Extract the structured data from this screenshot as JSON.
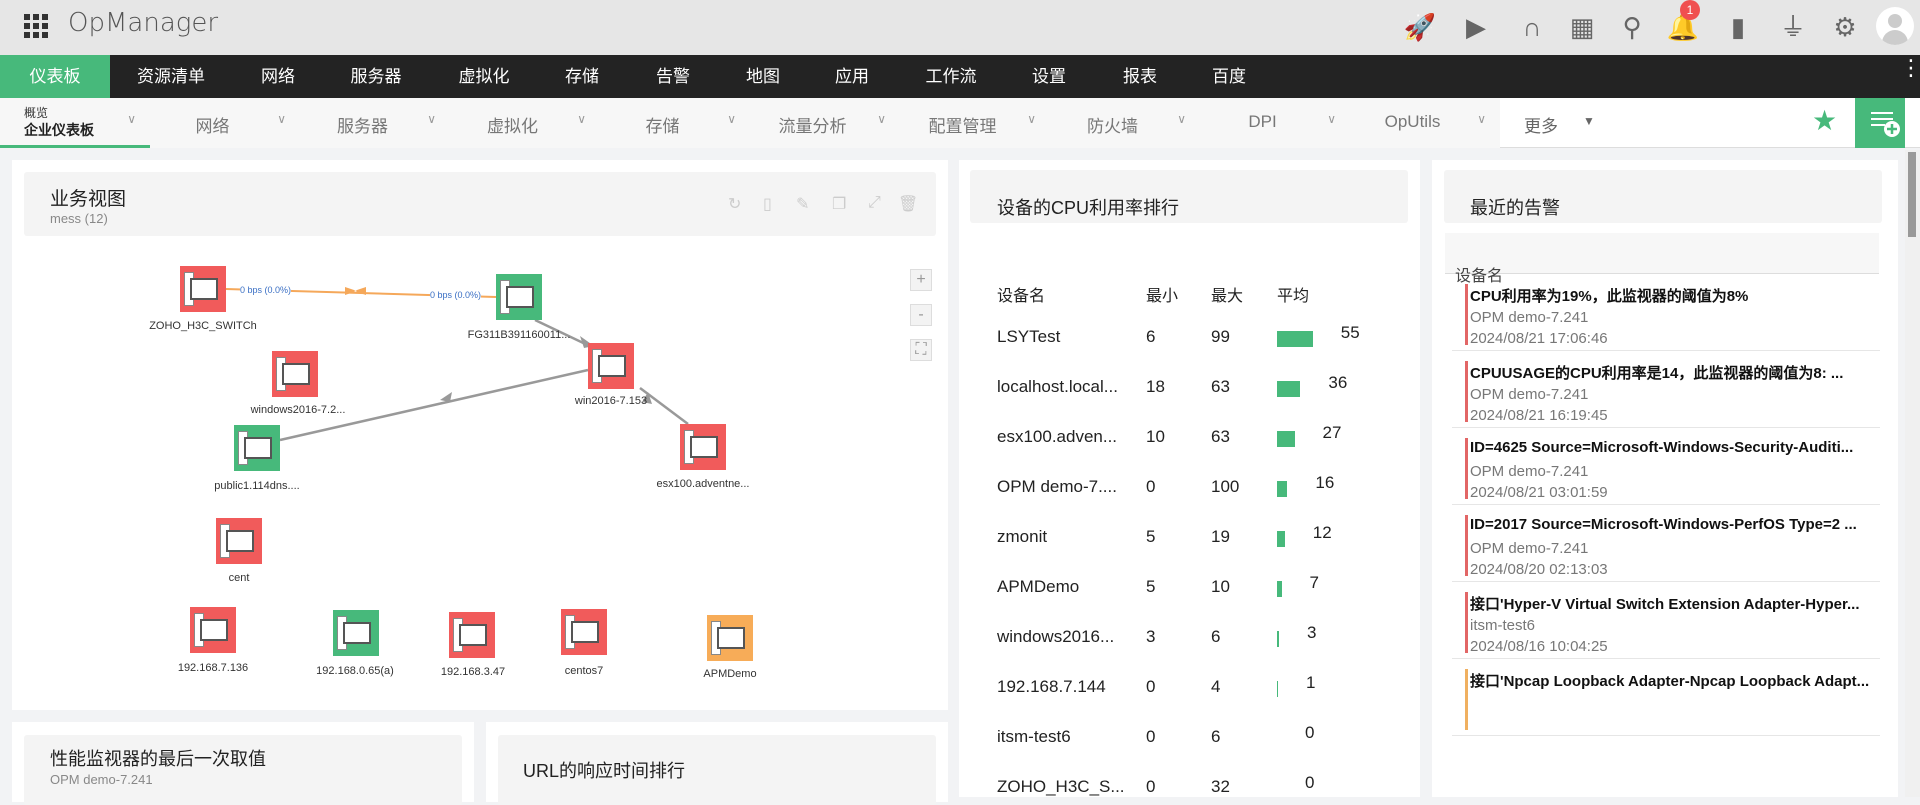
{
  "app": {
    "title": "OpManager",
    "notification_count": "1"
  },
  "topbar_icons": [
    "rocket-icon",
    "presentation-icon",
    "headset-icon",
    "gift-icon",
    "search-icon",
    "bell-icon",
    "device-icon",
    "plug-icon",
    "gear-icon",
    "avatar-icon"
  ],
  "main_nav": [
    "仪表板",
    "资源清单",
    "网络",
    "服务器",
    "虚拟化",
    "存储",
    "告警",
    "地图",
    "应用",
    "工作流",
    "设置",
    "报表",
    "百度"
  ],
  "sub_nav": {
    "first_small": "概览",
    "first_big": "企业仪表板",
    "items": [
      "网络",
      "服务器",
      "虚拟化",
      "存储",
      "流量分析",
      "配置管理",
      "防火墙",
      "DPI",
      "OpUtils"
    ],
    "more": "更多"
  },
  "business_view": {
    "title": "业务视图",
    "subtitle": "mess (12)",
    "link_labels": [
      "0 bps (0.0%)",
      "0 bps (0.0%)"
    ],
    "nodes": [
      {
        "label": "ZOHO_H3C_SWITCh",
        "status": "#f15b5b"
      },
      {
        "label": "FG311B391160011...",
        "status": "#47b97b"
      },
      {
        "label": "windows2016-7.2...",
        "status": "#f15b5b"
      },
      {
        "label": "win2016-7.153",
        "status": "#f15b5b"
      },
      {
        "label": "public1.114dns....",
        "status": "#47b97b"
      },
      {
        "label": "esx100.adventne...",
        "status": "#f15b5b"
      },
      {
        "label": "cent",
        "status": "#f15b5b"
      },
      {
        "label": "192.168.7.136",
        "status": "#f15b5b"
      },
      {
        "label": "192.168.0.65(a)",
        "status": "#47b97b"
      },
      {
        "label": "192.168.3.47",
        "status": "#f15b5b"
      },
      {
        "label": "centos7",
        "status": "#f15b5b"
      },
      {
        "label": "APMDemo",
        "status": "#f7ac58"
      }
    ],
    "zoom": {
      "in": "+",
      "out": "-"
    }
  },
  "cpu": {
    "title": "设备的CPU利用率排行",
    "headers": [
      "设备名",
      "最小",
      "最大",
      "平均"
    ],
    "rows": [
      {
        "name": "LSYTest",
        "min": "6",
        "max": "99",
        "avg": "55"
      },
      {
        "name": "localhost.local...",
        "min": "18",
        "max": "63",
        "avg": "36"
      },
      {
        "name": "esx100.adven...",
        "min": "10",
        "max": "63",
        "avg": "27"
      },
      {
        "name": "OPM demo-7....",
        "min": "0",
        "max": "100",
        "avg": "16"
      },
      {
        "name": "zmonit",
        "min": "5",
        "max": "19",
        "avg": "12"
      },
      {
        "name": "APMDemo",
        "min": "5",
        "max": "10",
        "avg": "7"
      },
      {
        "name": "windows2016...",
        "min": "3",
        "max": "6",
        "avg": "3"
      },
      {
        "name": "192.168.7.144",
        "min": "0",
        "max": "4",
        "avg": "1"
      },
      {
        "name": "itsm-test6",
        "min": "0",
        "max": "6",
        "avg": "0"
      },
      {
        "name": "ZOHO_H3C_S...",
        "min": "0",
        "max": "32",
        "avg": "0"
      }
    ]
  },
  "alerts": {
    "title": "最近的告警",
    "column": "设备名",
    "items": [
      {
        "title": "CPU利用率为19%，此监视器的阈值为8%",
        "device": "OPM demo-7.241",
        "time": "2024/08/21 17:06:46",
        "color": "#e26666"
      },
      {
        "title": "CPUUSAGE的CPU利用率是14，此监视器的阈值为8: ...",
        "device": "OPM demo-7.241",
        "time": "2024/08/21 16:19:45",
        "color": "#e26666"
      },
      {
        "title": "ID=4625 Source=Microsoft-Windows-Security-Auditi...",
        "device": "OPM demo-7.241",
        "time": "2024/08/21 03:01:59",
        "color": "#e26666"
      },
      {
        "title": "ID=2017 Source=Microsoft-Windows-PerfOS Type=2 ...",
        "device": "OPM demo-7.241",
        "time": "2024/08/20 02:13:03",
        "color": "#e26666"
      },
      {
        "title": "接口'Hyper-V Virtual Switch Extension Adapter-Hyper...",
        "device": "itsm-test6",
        "time": "2024/08/16 10:04:25",
        "color": "#e26666"
      },
      {
        "title": "接口'Npcap Loopback Adapter-Npcap Loopback Adapt...",
        "device": "",
        "time": "",
        "color": "#f0b060"
      }
    ]
  },
  "perf_panel": {
    "title": "性能监视器的最后一次取值",
    "subtitle": "OPM demo-7.241"
  },
  "url_panel": {
    "title": "URL的响应时间排行"
  }
}
